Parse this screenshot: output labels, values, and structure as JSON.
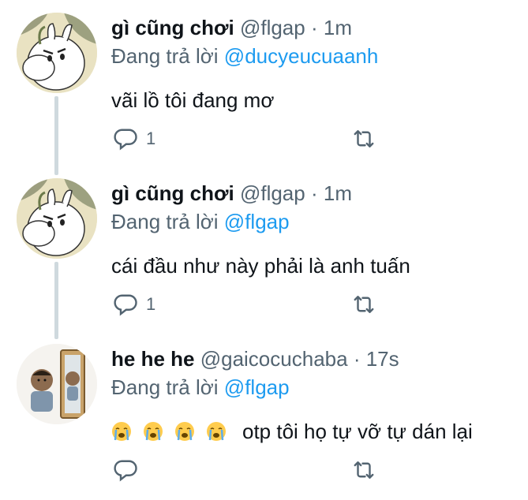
{
  "tweets": [
    {
      "name": "gì cũng chơi",
      "handle": "@flgap",
      "separator": "·",
      "time": "1m",
      "reply_prefix": "Đang trả lời",
      "reply_to": "@ducyeucuaanh",
      "text": "vãi lồ tôi đang mơ",
      "reply_count": "1",
      "avatar": "moomin-avatar"
    },
    {
      "name": "gì cũng chơi",
      "handle": "@flgap",
      "separator": "·",
      "time": "1m",
      "reply_prefix": "Đang trả lời",
      "reply_to": "@flgap",
      "text": "cái đầu như này phải là anh tuấn",
      "reply_count": "1",
      "avatar": "moomin-avatar"
    },
    {
      "name": "he he he",
      "handle": "@gaicocuchaba",
      "separator": "·",
      "time": "17s",
      "reply_prefix": "Đang trả lời",
      "reply_to": "@flgap",
      "emojis": [
        "😭",
        "😭",
        "😭",
        "😭"
      ],
      "text": "otp tôi họ tự vỡ tự dán lại",
      "reply_count": "",
      "avatar": "cartoon-mirror-avatar"
    }
  ],
  "colors": {
    "link": "#1d9bf0",
    "secondary": "#536471",
    "thread_line": "#cfd9de"
  }
}
